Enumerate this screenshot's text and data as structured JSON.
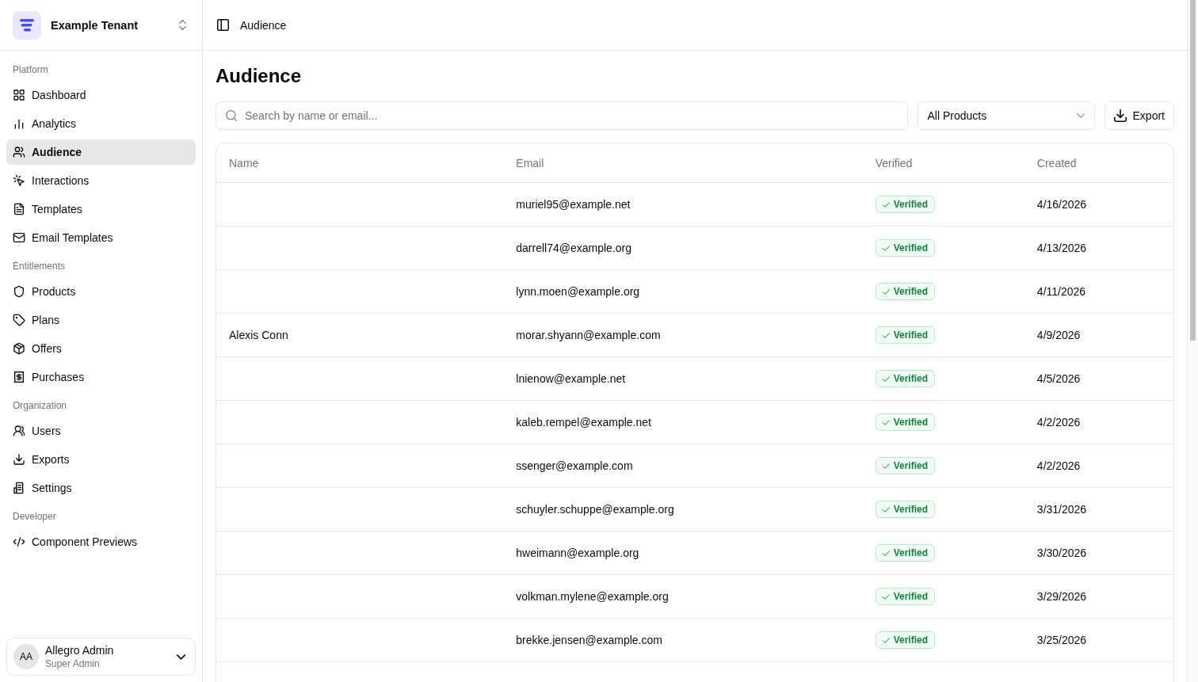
{
  "sidebar": {
    "tenant": {
      "name": "Example Tenant"
    },
    "groups": [
      {
        "label": "Platform",
        "items": [
          {
            "label": "Dashboard",
            "selected": false
          },
          {
            "label": "Analytics",
            "selected": false
          },
          {
            "label": "Audience",
            "selected": true
          },
          {
            "label": "Interactions",
            "selected": false
          },
          {
            "label": "Templates",
            "selected": false
          },
          {
            "label": "Email Templates",
            "selected": false
          }
        ]
      },
      {
        "label": "Entitlements",
        "items": [
          {
            "label": "Products",
            "selected": false
          },
          {
            "label": "Plans",
            "selected": false
          },
          {
            "label": "Offers",
            "selected": false
          },
          {
            "label": "Purchases",
            "selected": false
          }
        ]
      },
      {
        "label": "Organization",
        "items": [
          {
            "label": "Users",
            "selected": false
          },
          {
            "label": "Exports",
            "selected": false
          },
          {
            "label": "Settings",
            "selected": false
          }
        ]
      },
      {
        "label": "Developer",
        "items": [
          {
            "label": "Component Previews",
            "selected": false
          }
        ]
      }
    ],
    "user": {
      "initials": "AA",
      "name": "Allegro Admin",
      "role": "Super Admin"
    }
  },
  "header": {
    "breadcrumb": "Audience"
  },
  "page": {
    "title": "Audience"
  },
  "toolbar": {
    "search": {
      "placeholder": "Search by name or email..."
    },
    "filter": {
      "value": "All Products"
    },
    "export_button": "Export"
  },
  "table": {
    "columns": [
      "Name",
      "Email",
      "Verified",
      "Created"
    ],
    "rows": [
      {
        "email": "muriel95@example.net",
        "verified": true,
        "badge": "Verified",
        "created": "4/16/2026"
      },
      {
        "email": "darrell74@example.org",
        "verified": true,
        "badge": "Verified",
        "created": "4/13/2026"
      },
      {
        "email": "lynn.moen@example.org",
        "verified": true,
        "badge": "Verified",
        "created": "4/11/2026"
      },
      {
        "name": "Alexis Conn",
        "email": "morar.shyann@example.com",
        "verified": true,
        "badge": "Verified",
        "created": "4/9/2026"
      },
      {
        "email": "lnienow@example.net",
        "verified": true,
        "badge": "Verified",
        "created": "4/5/2026"
      },
      {
        "email": "kaleb.rempel@example.net",
        "verified": true,
        "badge": "Verified",
        "created": "4/2/2026"
      },
      {
        "email": "ssenger@example.com",
        "verified": true,
        "badge": "Verified",
        "created": "4/2/2026"
      },
      {
        "email": "schuyler.schuppe@example.org",
        "verified": true,
        "badge": "Verified",
        "created": "3/31/2026"
      },
      {
        "email": "hweimann@example.org",
        "verified": true,
        "badge": "Verified",
        "created": "3/30/2026"
      },
      {
        "email": "volkman.mylene@example.org",
        "verified": true,
        "badge": "Verified",
        "created": "3/29/2026"
      },
      {
        "email": "brekke.jensen@example.com",
        "verified": true,
        "badge": "Verified",
        "created": "3/25/2026"
      }
    ]
  }
}
